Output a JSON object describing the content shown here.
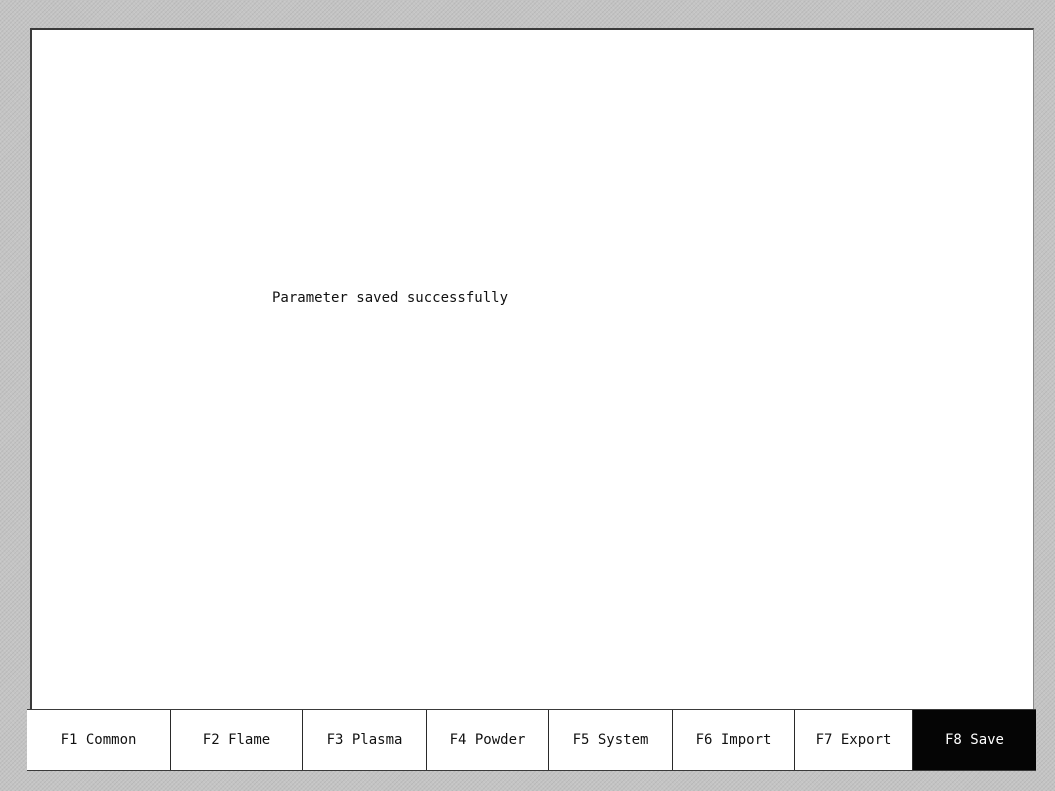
{
  "screen": {
    "message": "Parameter saved successfully"
  },
  "fkeys": [
    {
      "label": "F1 Common",
      "active": false
    },
    {
      "label": "F2 Flame",
      "active": false
    },
    {
      "label": "F3 Plasma",
      "active": false
    },
    {
      "label": "F4 Powder",
      "active": false
    },
    {
      "label": "F5 System",
      "active": false
    },
    {
      "label": "F6 Import",
      "active": false
    },
    {
      "label": "F7 Export",
      "active": false
    },
    {
      "label": "F8 Save",
      "active": true
    }
  ],
  "colors": {
    "frame": "#c4c4c4",
    "screen": "#ffffff",
    "active_key_bg": "#050505",
    "active_key_text": "#ffffff"
  }
}
